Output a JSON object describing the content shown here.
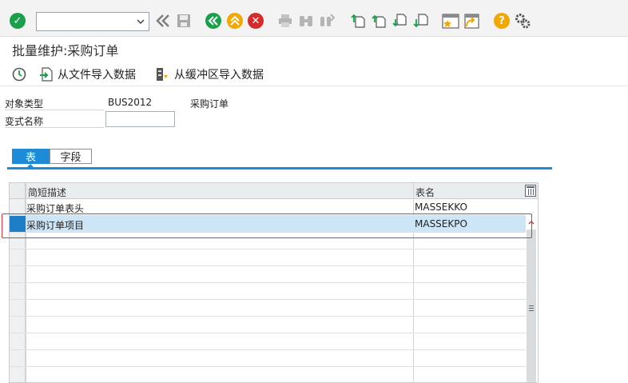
{
  "toolbar": {
    "enter_icon": "check-circle-icon",
    "command_value": "",
    "icons": [
      "back-double-icon",
      "save-icon",
      "back-icon",
      "exit-icon",
      "cancel-icon",
      "print-icon",
      "find-icon",
      "find-next-icon",
      "first-page-icon",
      "prev-page-icon",
      "next-page-icon",
      "last-page-icon",
      "create-session-icon",
      "shortcut-icon",
      "help-icon",
      "customize-icon"
    ]
  },
  "page": {
    "title": "批量维护:采购订单"
  },
  "app_toolbar": {
    "import_file_label": "从文件导入数据",
    "import_buffer_label": "从缓冲区导入数据"
  },
  "form": {
    "object_type_label": "对象类型",
    "object_type_value": "BUS2012",
    "object_type_desc": "采购订单",
    "variant_label": "变式名称",
    "variant_value": ""
  },
  "tabs": {
    "table_label": "表",
    "field_label": "字段"
  },
  "table": {
    "headers": {
      "desc": "简短描述",
      "name": "表名"
    },
    "rows": [
      {
        "desc": "采购订单表头",
        "name": "MASSEKKO"
      },
      {
        "desc": "采购订单项目",
        "name": "MASSEKPO"
      }
    ]
  },
  "colors": {
    "accent": "#1e8bd8",
    "ok_green": "#1aa04a",
    "warn_orange": "#f1a800",
    "cancel_red": "#d72b2b",
    "highlight_red": "#e0383a",
    "selected_row": "#cde6f7"
  }
}
